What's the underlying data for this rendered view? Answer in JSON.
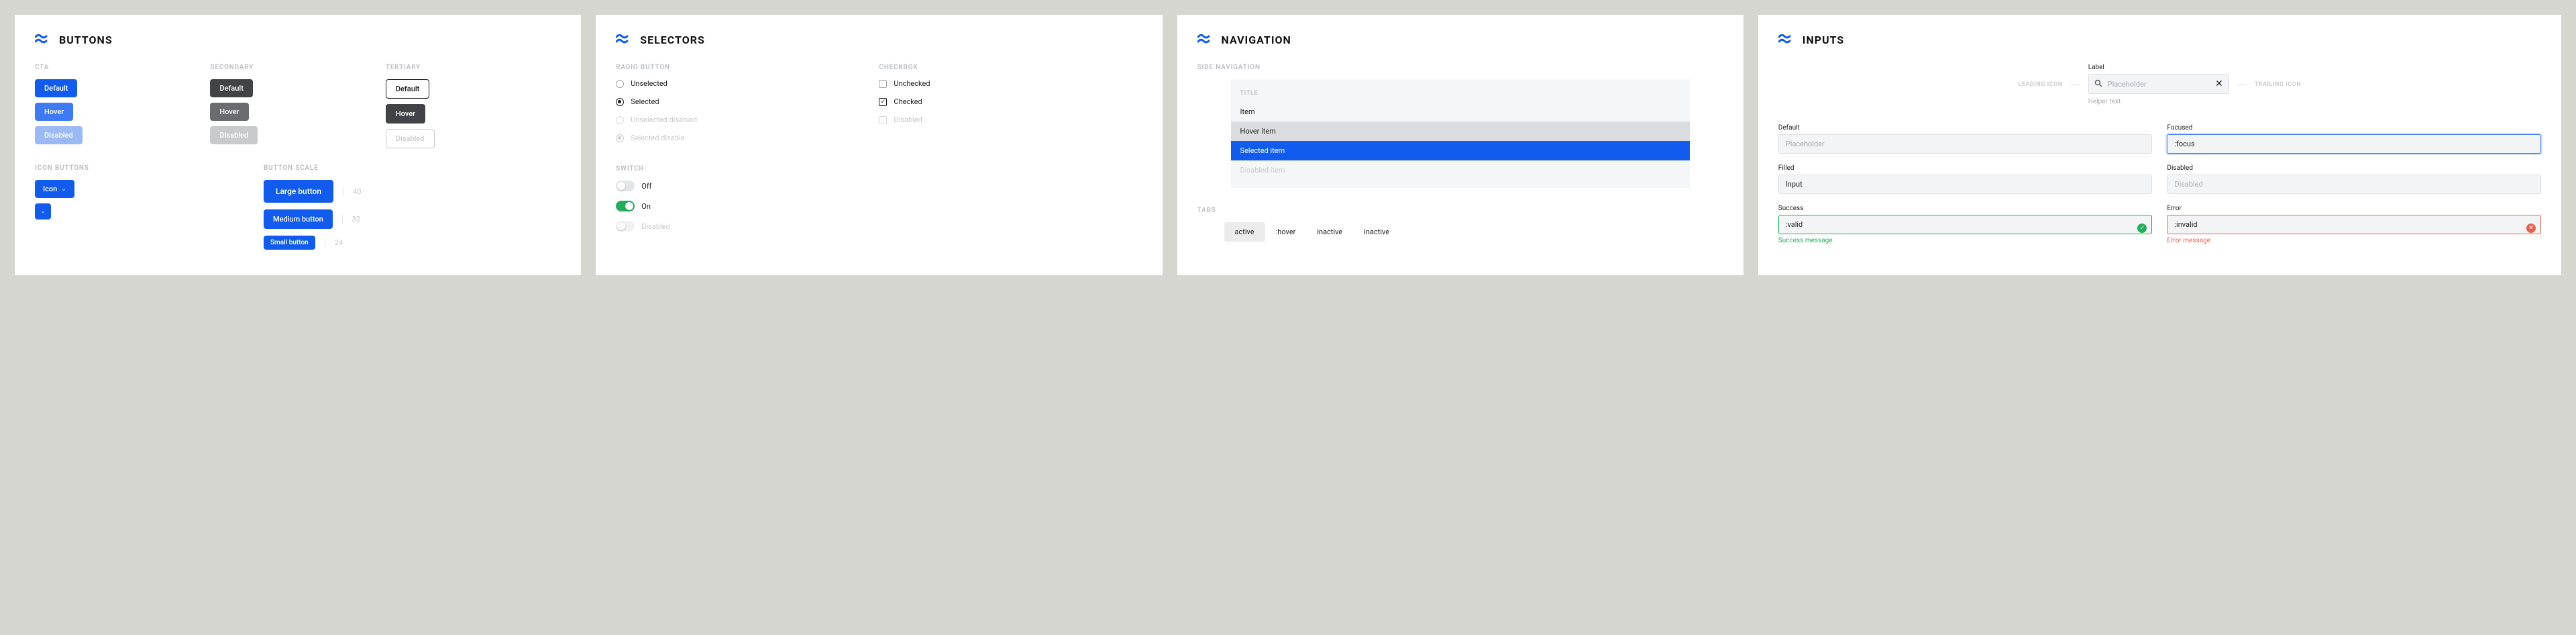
{
  "cards": {
    "buttons": {
      "title": "BUTTONS",
      "sections": {
        "cta": "CTA",
        "secondary": "SECONDARY",
        "tertiary": "TERTIARY",
        "icon_buttons": "ICON BUTTONS",
        "button_scale": "BUTTON SCALE"
      },
      "labels": {
        "default": "Default",
        "hover": "Hover",
        "disabled": "Disabled",
        "icon": "Icon",
        "large": "Large button",
        "medium": "Medium button",
        "small": "Small button"
      },
      "scale": {
        "large": "40",
        "medium": "32",
        "small": "24"
      }
    },
    "selectors": {
      "title": "SELECTORS",
      "sections": {
        "radio": "RADIO BUTTON",
        "checkbox": "CHECKBOX",
        "switch": "SWITCH"
      },
      "radio": {
        "unselected": "Unselected",
        "selected": "Selected",
        "unselected_disabled": "Unselected disabled",
        "selected_disabled": "Selected disable"
      },
      "checkbox": {
        "unchecked": "Unchecked",
        "checked": "Checked",
        "disabled": "Disabled"
      },
      "switch": {
        "off": "Off",
        "on": "On",
        "disabled": "Disabled"
      }
    },
    "navigation": {
      "title": "NAVIGATION",
      "sections": {
        "side_nav": "SIDE NAVIGATION",
        "tabs": "TABS"
      },
      "side_nav": {
        "title": "TITLE",
        "item": "Item",
        "hover": "Hover item",
        "selected": "Selected item",
        "disabled": "Disabled item"
      },
      "tabs": [
        "active",
        ":hover",
        "inactive",
        "inactive"
      ]
    },
    "inputs": {
      "title": "INPUTS",
      "anatomy": {
        "leading": "LEADING ICON",
        "trailing": "TRAILING ICON",
        "label": "Label",
        "placeholder": "Placeholder",
        "helper": "Helper text"
      },
      "fields": {
        "default": {
          "label": "Default",
          "placeholder": "Placeholder"
        },
        "focused": {
          "label": "Focused",
          "value": ":focus"
        },
        "filled": {
          "label": "Filled",
          "value": "Input"
        },
        "disabled": {
          "label": "Disabled",
          "placeholder": "Disabled"
        },
        "success": {
          "label": "Success",
          "value": ":valid",
          "message": "Success message"
        },
        "error": {
          "label": "Error",
          "value": ":invalid",
          "message": "Error message"
        }
      }
    }
  }
}
